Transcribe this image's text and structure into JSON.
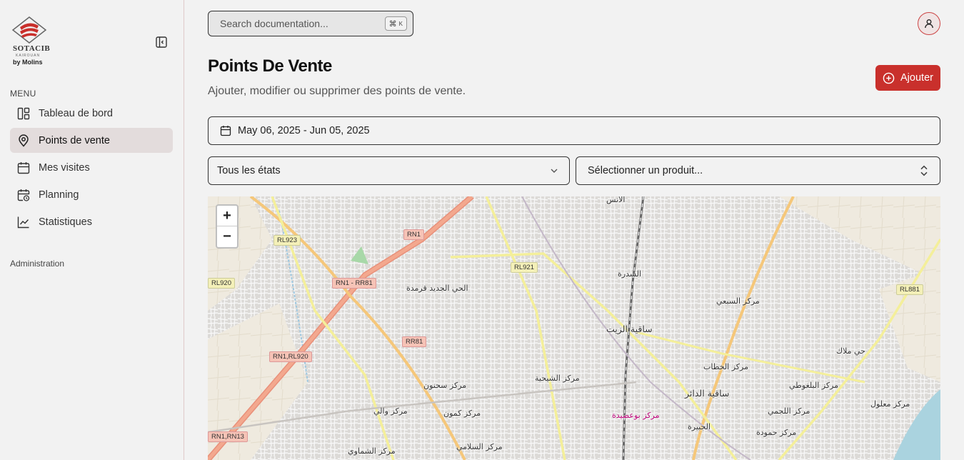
{
  "brand": {
    "name": "SOTACIB",
    "sub": "KAIROUAN",
    "by": "by Molins"
  },
  "sidebar": {
    "menu_label": "MENU",
    "items": [
      {
        "label": "Tableau de bord",
        "icon": "dashboard-icon"
      },
      {
        "label": "Points de vente",
        "icon": "map-pin-icon",
        "active": true
      },
      {
        "label": "Mes visites",
        "icon": "calendar-icon"
      },
      {
        "label": "Planning",
        "icon": "calendar-clock-icon"
      },
      {
        "label": "Statistiques",
        "icon": "chart-line-icon"
      }
    ],
    "admin_label": "Administration"
  },
  "search": {
    "placeholder": "Search documentation...",
    "shortcut_key": "⌘",
    "shortcut_letter": "K"
  },
  "header": {
    "title": "Points De Vente",
    "subtitle": "Ajouter, modifier ou supprimer des points de vente.",
    "add_label": "Ajouter"
  },
  "filters": {
    "date_range": "May 06, 2025 - Jun 05, 2025",
    "states_value": "Tous les états",
    "product_value": "Sélectionner un produit..."
  },
  "map": {
    "zoom_in": "+",
    "zoom_out": "−",
    "places": [
      "الأنس",
      "السدرة",
      "الحي الجديد قرمدة",
      "ساقية الزيت",
      "مركز السبعي",
      "حي ملاك",
      "مركز الخطاب",
      "ساقية الدائر",
      "مركز الشيحية",
      "مركز سحنون",
      "مركز كمون",
      "مركز والي",
      "مركز البلغوطي",
      "مركز اللجمي",
      "مركز معلول",
      "مركز حمودة",
      "الجبيرة",
      "مركز السلامي",
      "مركز الشماوي",
      "مركز بوعصيدة"
    ],
    "roads": [
      "RN1",
      "RL923",
      "RN1 - RR81",
      "RL920",
      "RR81",
      "RN1,RL920",
      "RL921",
      "RL881",
      "RN1,RN13"
    ]
  },
  "colors": {
    "accent": "#c9302c",
    "active_nav": "#e3dcdc"
  }
}
